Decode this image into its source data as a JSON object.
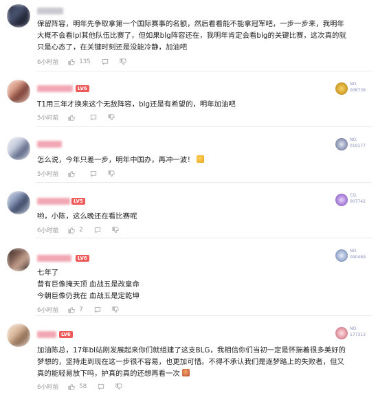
{
  "icons": {
    "like": "thumbs-up-icon",
    "comment": "comment-icon",
    "dislike": "thumbs-down-icon"
  },
  "colors": {
    "level_badge": "#ef5a5a",
    "meta_text": "#999999",
    "divider": "#ececec"
  },
  "comments": [
    {
      "level": "",
      "text": "保留阵容，明年先争取拿第一个国际赛事的名额，然后看看能不能拿冠军吧，一步一步来，我明年大概不会看lpl其他队伍比赛了，但如果blg阵容还在，我明年肯定会看blg的关键比赛，这次真的就只是心态了，在关键时刻还是没能冷静，加油吧",
      "time": "6小时前",
      "likes": "135",
      "badge": null
    },
    {
      "level": "LV6",
      "text": "T1用三年才换来这个无敌阵容，blg还是有希望的，明年加油吧",
      "time": "5小时前",
      "likes": "",
      "badge": {
        "top": "NO.",
        "bottom": "008736"
      }
    },
    {
      "level": "",
      "text": "怎么说，今年只差一步，明年中国办，再冲一波！",
      "time": "5小时前",
      "likes": "",
      "badge": {
        "top": "NO.",
        "bottom": "019177"
      }
    },
    {
      "level": "LV5",
      "text": "哟，小陈，这么晚还在看比赛呢",
      "time": "6小时前",
      "likes": "2",
      "badge": {
        "top": "CQ.",
        "bottom": "007742"
      }
    },
    {
      "level": "LV6",
      "lines": [
        "七年了",
        "昔有巨像掩天顶 血战五是改皇命",
        "今朝巨像仍我在 血战五是定乾坤"
      ],
      "time": "6小时前",
      "likes": "7",
      "badge": {
        "top": "NO.",
        "bottom": "090489"
      }
    },
    {
      "level": "LV6",
      "text": "加油陈总，17年bl站刚发展起来你们就组建了这支BLG，我相信你们当初一定是怀揣着很多美好的梦想的，坚持走到现在这一步很不容易，也更加可惜。不得不承认我们是逐梦路上的失败者，但又真的能轻易放下吗，护真的真的还想再看一次",
      "time": "6小时前",
      "likes": "58",
      "badge": {
        "top": "NO.",
        "bottom": "177313"
      }
    }
  ]
}
